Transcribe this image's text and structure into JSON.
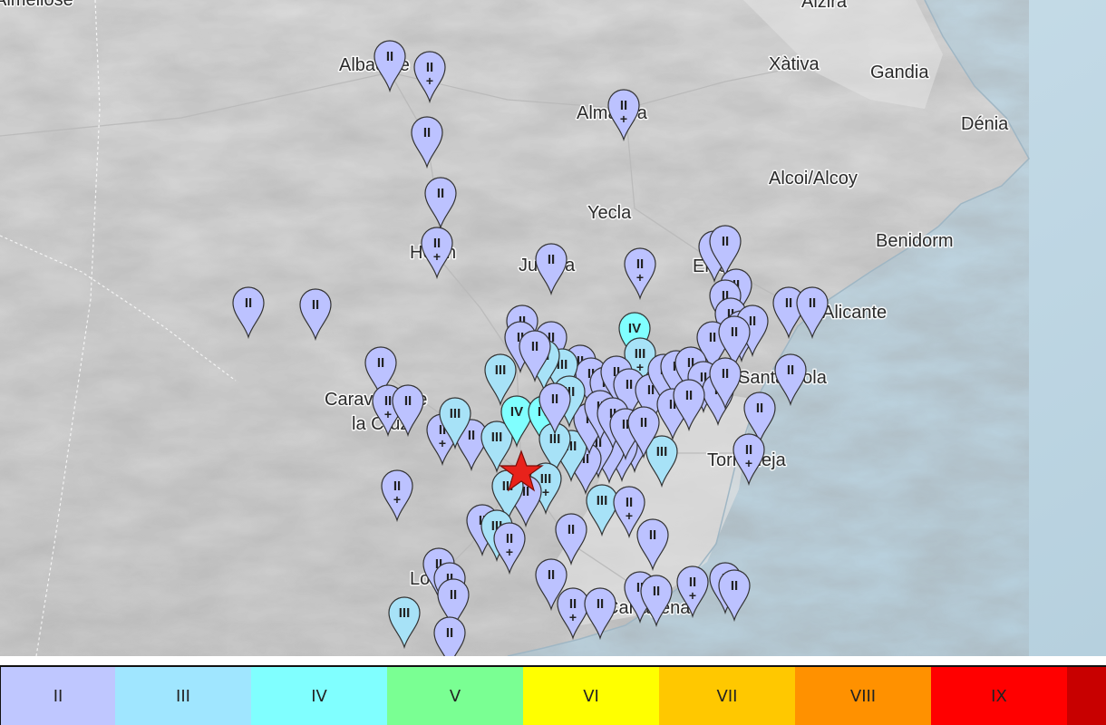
{
  "map": {
    "cities": [
      {
        "name": "Albacete"
      },
      {
        "name": "Almansa"
      },
      {
        "name": "Xàtiva"
      },
      {
        "name": "Gandia"
      },
      {
        "name": "Dénia"
      },
      {
        "name": "Alcoi/Alcoy"
      },
      {
        "name": "Yecla"
      },
      {
        "name": "Benidorm"
      },
      {
        "name": "Hellín"
      },
      {
        "name": "Jumilla"
      },
      {
        "name": "Elda"
      },
      {
        "name": "Alicante"
      },
      {
        "name": "Santa Pola"
      },
      {
        "name": "Caravaca de"
      },
      {
        "name": "la Cruz"
      },
      {
        "name": "Torrevieja"
      },
      {
        "name": "Lorca"
      },
      {
        "name": "Cartagena"
      },
      {
        "name": "Alzira"
      },
      {
        "name": "Almeliosé"
      }
    ],
    "epicenter": {
      "symbol": "star",
      "color": "#e8221b"
    },
    "pin_colors": {
      "II": "#bcc2ff",
      "III": "#a7e2f7",
      "IV": "#80ffff"
    }
  },
  "intensity_scale": [
    {
      "label": "II",
      "color": "#bfc7ff"
    },
    {
      "label": "III",
      "color": "#a0e6ff"
    },
    {
      "label": "IV",
      "color": "#80ffff"
    },
    {
      "label": "V",
      "color": "#7aff93"
    },
    {
      "label": "VI",
      "color": "#ffff00"
    },
    {
      "label": "VII",
      "color": "#ffc800"
    },
    {
      "label": "VIII",
      "color": "#ff9100"
    },
    {
      "label": "IX",
      "color": "#ff0000"
    },
    {
      "label": "",
      "color": "#c80000"
    }
  ]
}
